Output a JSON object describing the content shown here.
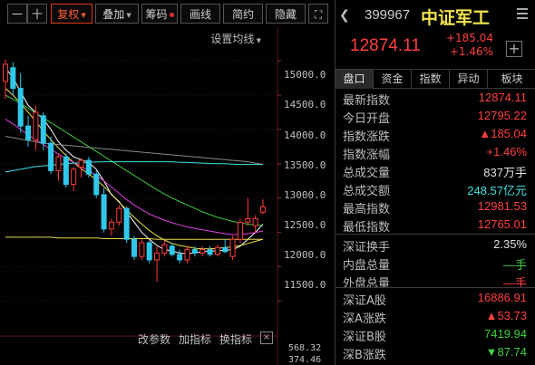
{
  "toolbar": {
    "minus": "一",
    "plus": "十",
    "fuquan": "复权",
    "diejia": "叠加",
    "chouma": "筹码",
    "huaxian": "画线",
    "jianyue": "简约",
    "yincang": "隐藏",
    "expand": "⛶",
    "ma_settings": "设置均线"
  },
  "price_axis": [
    "15000.0",
    "14500.0",
    "14000.0",
    "13500.0",
    "13000.0",
    "12500.0",
    "12000.0",
    "11500.0"
  ],
  "bottom_bar": {
    "gai_canshu": "改参数",
    "jia_zhibiao": "加指标",
    "huan_zhibiao": "换指标",
    "close": "×",
    "vol_top": "568.32",
    "vol_bottom": "374.46"
  },
  "chart_data": {
    "type": "candlestick",
    "candles": [
      {
        "o": 14700,
        "h": 15020,
        "l": 14450,
        "c": 14950
      },
      {
        "o": 14900,
        "h": 14980,
        "l": 14500,
        "c": 14600
      },
      {
        "o": 14600,
        "h": 14820,
        "l": 13950,
        "c": 14050
      },
      {
        "o": 14050,
        "h": 14200,
        "l": 13750,
        "c": 13850
      },
      {
        "o": 13850,
        "h": 14350,
        "l": 13700,
        "c": 14250
      },
      {
        "o": 14200,
        "h": 14250,
        "l": 13700,
        "c": 13800
      },
      {
        "o": 13800,
        "h": 13900,
        "l": 13350,
        "c": 13400
      },
      {
        "o": 13400,
        "h": 13650,
        "l": 13250,
        "c": 13600
      },
      {
        "o": 13600,
        "h": 13650,
        "l": 13150,
        "c": 13200
      },
      {
        "o": 13200,
        "h": 13450,
        "l": 13100,
        "c": 13420
      },
      {
        "o": 13450,
        "h": 13580,
        "l": 13300,
        "c": 13550
      },
      {
        "o": 13550,
        "h": 13600,
        "l": 13300,
        "c": 13350
      },
      {
        "o": 13350,
        "h": 13400,
        "l": 13000,
        "c": 13050
      },
      {
        "o": 13050,
        "h": 13150,
        "l": 12500,
        "c": 12550
      },
      {
        "o": 12550,
        "h": 12700,
        "l": 12450,
        "c": 12650
      },
      {
        "o": 12650,
        "h": 12900,
        "l": 12600,
        "c": 12850
      },
      {
        "o": 12850,
        "h": 12880,
        "l": 12350,
        "c": 12400
      },
      {
        "o": 12400,
        "h": 12450,
        "l": 12100,
        "c": 12150
      },
      {
        "o": 12150,
        "h": 12400,
        "l": 12100,
        "c": 12350
      },
      {
        "o": 12350,
        "h": 12380,
        "l": 12050,
        "c": 12100
      },
      {
        "o": 12100,
        "h": 12300,
        "l": 11780,
        "c": 12200
      },
      {
        "o": 12200,
        "h": 12380,
        "l": 12150,
        "c": 12320
      },
      {
        "o": 12300,
        "h": 12350,
        "l": 12150,
        "c": 12180
      },
      {
        "o": 12180,
        "h": 12250,
        "l": 12050,
        "c": 12100
      },
      {
        "o": 12100,
        "h": 12300,
        "l": 12050,
        "c": 12250
      },
      {
        "o": 12250,
        "h": 12300,
        "l": 12150,
        "c": 12200
      },
      {
        "o": 12200,
        "h": 12300,
        "l": 12150,
        "c": 12250
      },
      {
        "o": 12250,
        "h": 12300,
        "l": 12150,
        "c": 12180
      },
      {
        "o": 12180,
        "h": 12320,
        "l": 12150,
        "c": 12280
      },
      {
        "o": 12280,
        "h": 12400,
        "l": 12200,
        "c": 12220
      },
      {
        "o": 12150,
        "h": 12450,
        "l": 12100,
        "c": 12400
      },
      {
        "o": 12400,
        "h": 12700,
        "l": 12350,
        "c": 12650
      },
      {
        "o": 12650,
        "h": 13000,
        "l": 12600,
        "c": 12700
      },
      {
        "o": 12600,
        "h": 12750,
        "l": 12500,
        "c": 12700
      },
      {
        "o": 12795,
        "h": 12981,
        "l": 12765,
        "c": 12874
      }
    ],
    "ma_series": [
      {
        "color": "#ffffff",
        "values": [
          14900,
          14750,
          14550,
          14350,
          14250,
          14150,
          14000,
          13820,
          13700,
          13600,
          13560,
          13520,
          13420,
          13250,
          13050,
          12950,
          12800,
          12650,
          12500,
          12400,
          12310,
          12250,
          12230,
          12200,
          12190,
          12200,
          12220,
          12230,
          12230,
          12240,
          12250,
          12300,
          12400,
          12500,
          12620
        ]
      },
      {
        "color": "#f0e34a",
        "values": [
          14600,
          14500,
          14380,
          14250,
          14120,
          13980,
          13850,
          13730,
          13620,
          13520,
          13430,
          13350,
          13270,
          13170,
          13060,
          12940,
          12830,
          12720,
          12620,
          12530,
          12450,
          12390,
          12340,
          12310,
          12290,
          12270,
          12260,
          12260,
          12270,
          12280,
          12290,
          12310,
          12340,
          12370,
          12400
        ]
      },
      {
        "color": "#e040e0",
        "values": [
          14150,
          14080,
          14000,
          13920,
          13850,
          13780,
          13710,
          13640,
          13580,
          13520,
          13460,
          13400,
          13330,
          13250,
          13160,
          13070,
          12980,
          12900,
          12830,
          12770,
          12720,
          12680,
          12640,
          12610,
          12580,
          12560,
          12540,
          12520,
          12500,
          12480,
          12470,
          12470,
          12480,
          12500,
          12520
        ]
      },
      {
        "color": "#3ecf3e",
        "values": [
          14500,
          14440,
          14380,
          14310,
          14240,
          14170,
          14100,
          14030,
          13960,
          13890,
          13820,
          13750,
          13680,
          13610,
          13540,
          13470,
          13400,
          13330,
          13260,
          13190,
          13120,
          13060,
          13000,
          12950,
          12900,
          12850,
          12800,
          12760,
          12720,
          12690,
          12660,
          12640,
          12620,
          12610,
          12600
        ]
      },
      {
        "color": "#8a8a8a",
        "values": [
          13900,
          13880,
          13860,
          13840,
          13820,
          13800,
          13790,
          13780,
          13770,
          13760,
          13750,
          13740,
          13730,
          13720,
          13710,
          13700,
          13690,
          13680,
          13670,
          13660,
          13650,
          13640,
          13630,
          13620,
          13610,
          13600,
          13590,
          13580,
          13570,
          13560,
          13550,
          13540,
          13530,
          13510,
          13490
        ]
      },
      {
        "color": "#3ee0e0",
        "values": [
          13380,
          13400,
          13420,
          13440,
          13460,
          13470,
          13480,
          13490,
          13500,
          13510,
          13515,
          13520,
          13525,
          13530,
          13530,
          13530,
          13530,
          13530,
          13530,
          13530,
          13530,
          13530,
          13530,
          13520,
          13520,
          13515,
          13510,
          13505,
          13500,
          13500,
          13495,
          13490,
          13490,
          13490,
          13490
        ]
      },
      {
        "color": "#e8d84a",
        "values": [
          12430,
          12430,
          12430,
          12430,
          12430,
          12430,
          12430,
          12420,
          12420,
          12420,
          12420,
          12420,
          12420,
          12410,
          12410,
          12410,
          12410,
          12410,
          12410,
          12410,
          12400,
          12400,
          12400,
          12400,
          12400,
          12400,
          12400,
          12400,
          12400,
          12400,
          12400,
          12400,
          12400,
          12400,
          12400
        ]
      }
    ],
    "ylim": [
      11400,
      15200
    ]
  },
  "header": {
    "nav": "❮",
    "code": "399967",
    "name": "中证军工",
    "price": "12874.11",
    "change": "+185.04",
    "change_pct": "+1.46%",
    "plus": "+"
  },
  "tabs": [
    "盘口",
    "资金",
    "指数",
    "异动",
    "板块"
  ],
  "quote_rows": [
    {
      "label": "最新指数",
      "value": "12874.11",
      "color": "red"
    },
    {
      "label": "今日开盘",
      "value": "12795.22",
      "color": "red"
    },
    {
      "label": "指数涨跌",
      "value": "▲185.04",
      "color": "red"
    },
    {
      "label": "指数涨幅",
      "value": "+1.46%",
      "color": "red"
    },
    {
      "label": "总成交量",
      "value": "837万手",
      "color": "white"
    },
    {
      "label": "总成交额",
      "value": "248.57亿元",
      "color": "cyan"
    },
    {
      "label": "最高指数",
      "value": "12981.53",
      "color": "red"
    },
    {
      "label": "最低指数",
      "value": "12765.01",
      "color": "red"
    }
  ],
  "volume_rows": [
    {
      "label": "深证换手",
      "value": "2.35%",
      "color": "white"
    },
    {
      "label": "内盘总量",
      "value": "—手",
      "color": "green"
    },
    {
      "label": "外盘总量",
      "value": "—手",
      "color": "red"
    }
  ],
  "market_rows": [
    {
      "label": "深证A股",
      "value": "16886.91",
      "color": "red"
    },
    {
      "label": "深A涨跌",
      "value": "▲53.73",
      "color": "red"
    },
    {
      "label": "深证B股",
      "value": "7419.94",
      "color": "green"
    },
    {
      "label": "深B涨跌",
      "value": "▼87.74",
      "color": "green"
    }
  ]
}
